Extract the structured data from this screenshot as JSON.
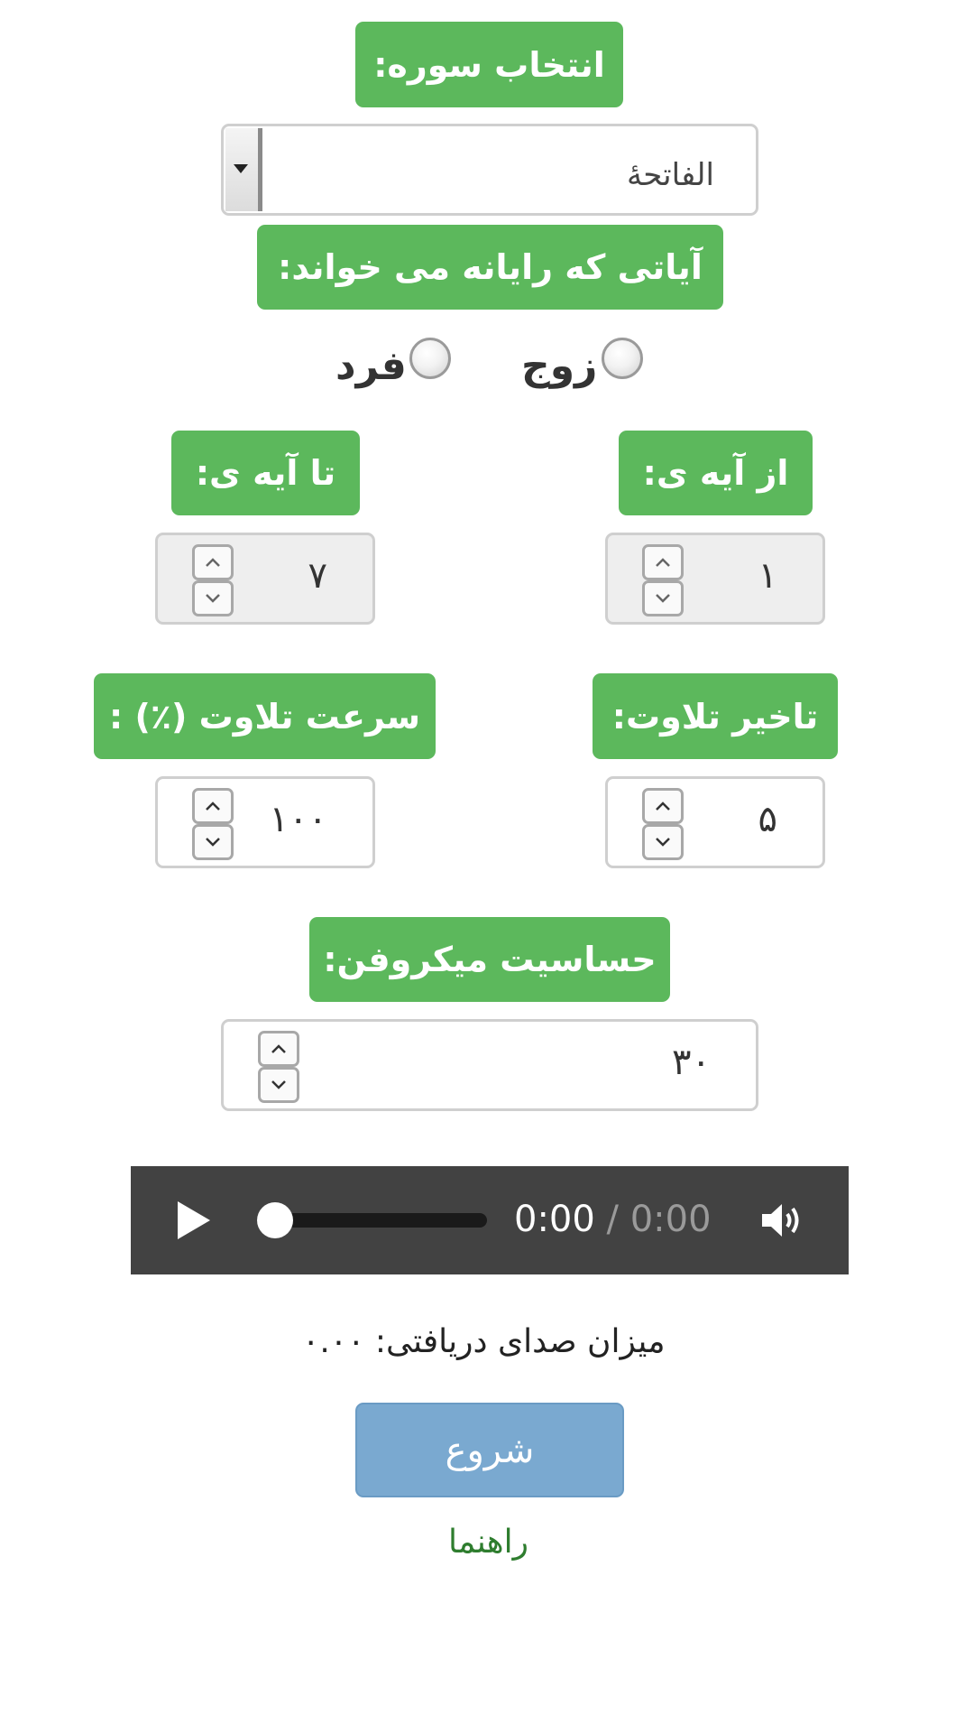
{
  "surah": {
    "label": "انتخاب سوره:",
    "selected": "الفاتحۀ"
  },
  "verses_read": {
    "label": "آیاتی که رایانه می خواند:",
    "options": [
      "زوج",
      "فرد"
    ]
  },
  "from_verse": {
    "label": "از آیه ی:",
    "value": "۱"
  },
  "to_verse": {
    "label": "تا آیه ی:",
    "value": "۷"
  },
  "recite_delay": {
    "label": "تاخیر تلاوت:",
    "value": "۵"
  },
  "recite_speed": {
    "label": "سرعت تلاوت (٪) :",
    "value": "۱۰۰"
  },
  "mic_sensitivity": {
    "label": "حساسیت میکروفن:",
    "value": "۳۰"
  },
  "player": {
    "current_time": "0:00",
    "separator": " / ",
    "duration": "0:00",
    "progress": 0
  },
  "received_volume": {
    "text": "میزان صدای دریافتی: ۰.۰۰"
  },
  "start_button": {
    "label": "شروع"
  },
  "help_link": {
    "label": "راهنما"
  },
  "colors": {
    "label_bg": "#5cb85c",
    "start_bg": "#7aa9d0",
    "player_bg": "#424242",
    "help_text": "#2e7d2e"
  },
  "icons": [
    "dropdown-arrow-icon",
    "chevron-up-icon",
    "chevron-down-icon",
    "play-icon",
    "volume-icon"
  ]
}
